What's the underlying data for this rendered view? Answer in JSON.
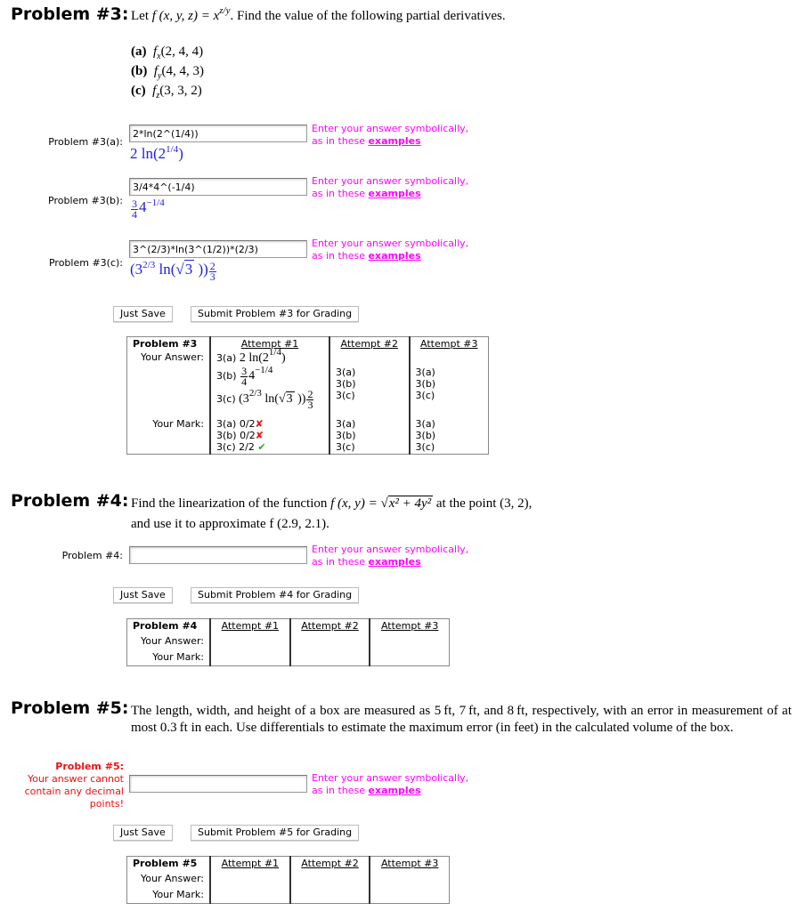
{
  "problem3": {
    "title": "Problem #3:",
    "statement": {
      "prefix": "Let ",
      "func": "f (x, y, z) = x",
      "exp": "z/y",
      "suffix": ". Find the value of the following partial derivatives."
    },
    "parts": [
      {
        "label": "(a)",
        "fn": "f",
        "sub": "x",
        "args": "(2, 4, 4)"
      },
      {
        "label": "(b)",
        "fn": "f",
        "sub": "y",
        "args": "(4, 4, 3)"
      },
      {
        "label": "(c)",
        "fn": "f",
        "sub": "z",
        "args": "(3, 3, 2)"
      }
    ],
    "answers": [
      {
        "label": "Problem #3(a):",
        "value": "2*ln(2^(1/4))",
        "preview": {
          "a": "2 ln(2",
          "sup": "1/4",
          "b": ")"
        }
      },
      {
        "label": "Problem #3(b):",
        "value": "3/4*4^(-1/4)",
        "preview": {
          "num": "3",
          "den": "4",
          "base": "4",
          "sup": "−1/4"
        }
      },
      {
        "label": "Problem #3(c):",
        "value": "3^(2/3)*ln(3^(1/2))*(2/3)",
        "preview": {
          "a": "(3",
          "sup": "2/3",
          "b": " ln(",
          "root": "3",
          "c": " ))",
          "num": "2",
          "den": "3"
        }
      }
    ],
    "just_save": "Just Save",
    "submit": "Submit Problem #3 for Grading",
    "table": {
      "head": "Problem #3",
      "attempts": [
        "Attempt #1",
        "Attempt #2",
        "Attempt #3"
      ],
      "your_answer": "Your Answer:",
      "your_mark": "Your Mark:",
      "attempt1_answers": [
        "3(a)",
        "3(b)",
        "3(c)"
      ],
      "attempt1_marks": [
        {
          "part": "3(a)",
          "score": "0/2",
          "status": "wrong"
        },
        {
          "part": "3(b)",
          "score": "0/2",
          "status": "wrong"
        },
        {
          "part": "3(c)",
          "score": "2/2",
          "status": "correct"
        }
      ],
      "attempt2_answers": [
        "3(a)",
        "3(b)",
        "3(c)"
      ],
      "attempt2_marks": [
        "3(a)",
        "3(b)",
        "3(c)"
      ],
      "attempt3_answers": [
        "3(a)",
        "3(b)",
        "3(c)"
      ],
      "attempt3_marks": [
        "3(a)",
        "3(b)",
        "3(c)"
      ]
    }
  },
  "problem4": {
    "title": "Problem #4:",
    "statement": {
      "l1a": "Find the linearization of the function ",
      "func": "f (x, y) = ",
      "rad": "x² + 4y²",
      "l1b": " at the point (3, 2),",
      "l2": "and use it to approximate f (2.9, 2.1)."
    },
    "label": "Problem #4:",
    "value": "",
    "just_save": "Just Save",
    "submit": "Submit Problem #4 for Grading",
    "table": {
      "head": "Problem #4",
      "attempts": [
        "Attempt #1",
        "Attempt #2",
        "Attempt #3"
      ],
      "your_answer": "Your Answer:",
      "your_mark": "Your Mark:"
    }
  },
  "problem5": {
    "title": "Problem #5:",
    "statement": "The length, width, and height of a box are measured as 5 ft, 7 ft, and 8 ft, respectively, with an error in measurement of at most 0.3 ft in each. Use differentials to estimate the maximum error (in feet) in the calculated volume of the box.",
    "label": "Problem #5:",
    "error": "Your answer cannot contain any decimal points!",
    "value": "",
    "just_save": "Just Save",
    "submit": "Submit Problem #5 for Grading",
    "table": {
      "head": "Problem #5",
      "attempts": [
        "Attempt #1",
        "Attempt #2",
        "Attempt #3"
      ],
      "your_answer": "Your Answer:",
      "your_mark": "Your Mark:"
    }
  },
  "hint": {
    "line1": "Enter your answer symbolically,",
    "line2": "as in these ",
    "link": "examples"
  },
  "marks": {
    "wrong": "✘",
    "correct": "✔"
  },
  "colors": {
    "hint": "#ff00ff",
    "preview": "#2020e0",
    "error": "#ee1111",
    "correct": "#22aa22"
  }
}
